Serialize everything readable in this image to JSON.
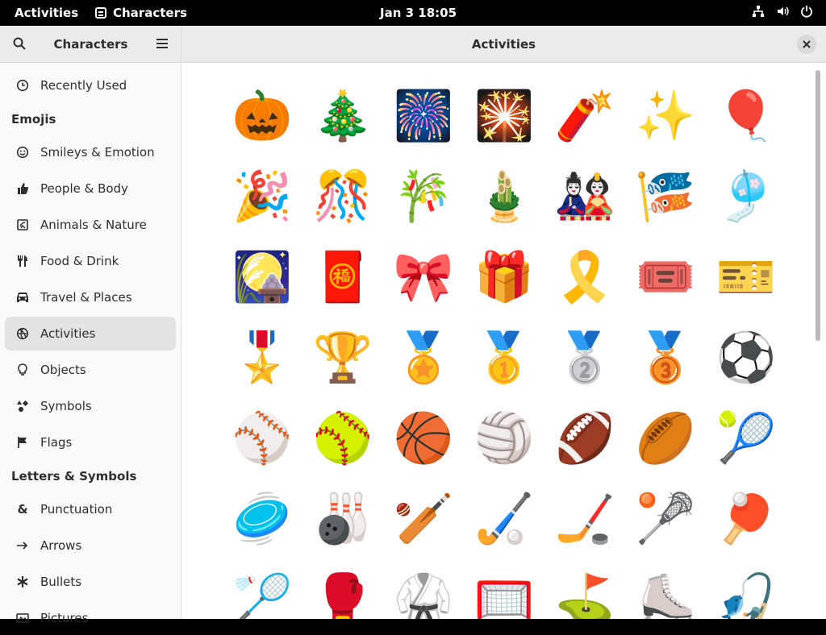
{
  "topbar": {
    "activities": "Activities",
    "app_name": "Characters",
    "clock": "Jan 3  18:05"
  },
  "sidebar": {
    "title": "Characters",
    "recently_used": "Recently Used",
    "sections": {
      "emojis": "Emojis",
      "letters": "Letters & Symbols"
    },
    "emoji_items": [
      {
        "label": "Smileys & Emotion",
        "icon": "smiley-icon"
      },
      {
        "label": "People & Body",
        "icon": "hand-icon"
      },
      {
        "label": "Animals & Nature",
        "icon": "animal-icon"
      },
      {
        "label": "Food & Drink",
        "icon": "cutlery-icon"
      },
      {
        "label": "Travel & Places",
        "icon": "car-icon"
      },
      {
        "label": "Activities",
        "icon": "ball-icon",
        "active": true
      },
      {
        "label": "Objects",
        "icon": "lightbulb-icon"
      },
      {
        "label": "Symbols",
        "icon": "symbols-icon"
      },
      {
        "label": "Flags",
        "icon": "flag-icon"
      }
    ],
    "letter_items": [
      {
        "label": "Punctuation",
        "icon": "ampersand-icon"
      },
      {
        "label": "Arrows",
        "icon": "arrow-icon"
      },
      {
        "label": "Bullets",
        "icon": "bullet-icon"
      },
      {
        "label": "Pictures",
        "icon": "picture-icon"
      }
    ]
  },
  "main": {
    "title": "Activities",
    "emojis": [
      "🎃",
      "🎄",
      "🎆",
      "🎇",
      "🧨",
      "✨",
      "🎈",
      "🎉",
      "🎊",
      "🎋",
      "🎍",
      "🎎",
      "🎏",
      "🎐",
      "🎑",
      "🧧",
      "🎀",
      "🎁",
      "🎗️",
      "🎟️",
      "🎫",
      "🎖️",
      "🏆",
      "🏅",
      "🥇",
      "🥈",
      "🥉",
      "⚽",
      "⚾",
      "🥎",
      "🏀",
      "🏐",
      "🏈",
      "🏉",
      "🎾",
      "🥏",
      "🎳",
      "🏏",
      "🏑",
      "🏒",
      "🥍",
      "🏓",
      "🏸",
      "🥊",
      "🥋",
      "🥅",
      "⛳",
      "⛸️",
      "🎣"
    ]
  }
}
